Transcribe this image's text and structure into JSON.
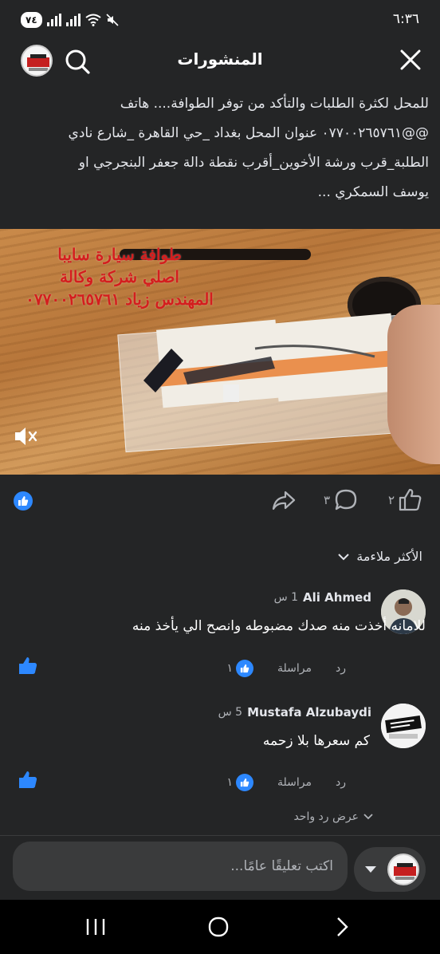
{
  "status_bar": {
    "time": "٦:٣٦",
    "battery": "٧٤",
    "signal_1_label": "LTE",
    "signal_2_label": "LTE"
  },
  "header": {
    "title": "المنشورات",
    "close_icon": "close-icon",
    "search_icon": "search-icon"
  },
  "post": {
    "text_lines": [
      "للمحل لكثرة الطلبات والتأكد من توفر الطوافة.... هاتف",
      "@@٠٧٧٠٠٢٦٥٧٦١ عنوان المحل بغداد _حي القاهرة _شارع نادي",
      "الطلبة_قرب ورشة الأخوين_أقرب نقطة دالة جعفر البنجرجي او",
      "يوسف السمكري ..."
    ],
    "video_overlay_lines": [
      "طوافة سيارة سايبا",
      "اصلي شركة وكالة",
      "المهندس زياد ٠٧٧٠٠٢٦٥٧٦١"
    ],
    "likes_count": "٢",
    "comments_count": "٣",
    "sort_label": "الأكثر ملاءمة"
  },
  "comments": [
    {
      "author": "Ali Ahmed",
      "time": "1 س",
      "text": "للامانه أخذت منه صدك مضبوطه وانصح الي يأخذ منه",
      "reply_label": "رد",
      "message_label": "مراسلة",
      "reaction_count": "١"
    },
    {
      "author": "Mustafa Alzubaydi",
      "time": "5 س",
      "text": "كم سعرها بلا زحمه",
      "reply_label": "رد",
      "message_label": "مراسلة",
      "reaction_count": "١"
    }
  ],
  "view_replies_label": "عرض رد واحد",
  "composer": {
    "placeholder": "اكتب تعليقًا عامًا..."
  },
  "colors": {
    "background": "#242526",
    "accent": "#2d88ff",
    "secondary_text": "#b0b3b8"
  }
}
